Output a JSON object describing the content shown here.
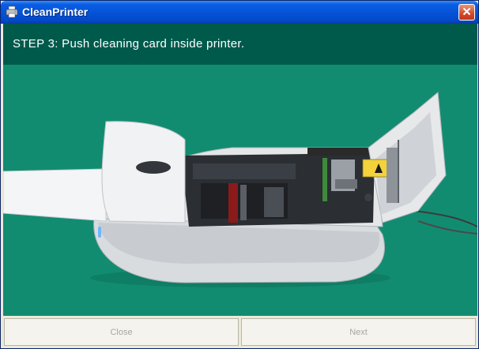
{
  "window": {
    "title": "CleanPrinter",
    "icon": "printer-icon",
    "close_icon": "close-icon"
  },
  "header": {
    "step_text": "STEP 3:  Push cleaning card inside printer."
  },
  "illustration": {
    "subject": "printer-photo",
    "background_color": "#128c71"
  },
  "footer": {
    "close_label": "Close",
    "next_label": "Next"
  },
  "colors": {
    "titlebar": "#0553d8",
    "header_bg": "#005a4c",
    "content_bg": "#128c71",
    "disabled_text": "#a9a79d"
  }
}
